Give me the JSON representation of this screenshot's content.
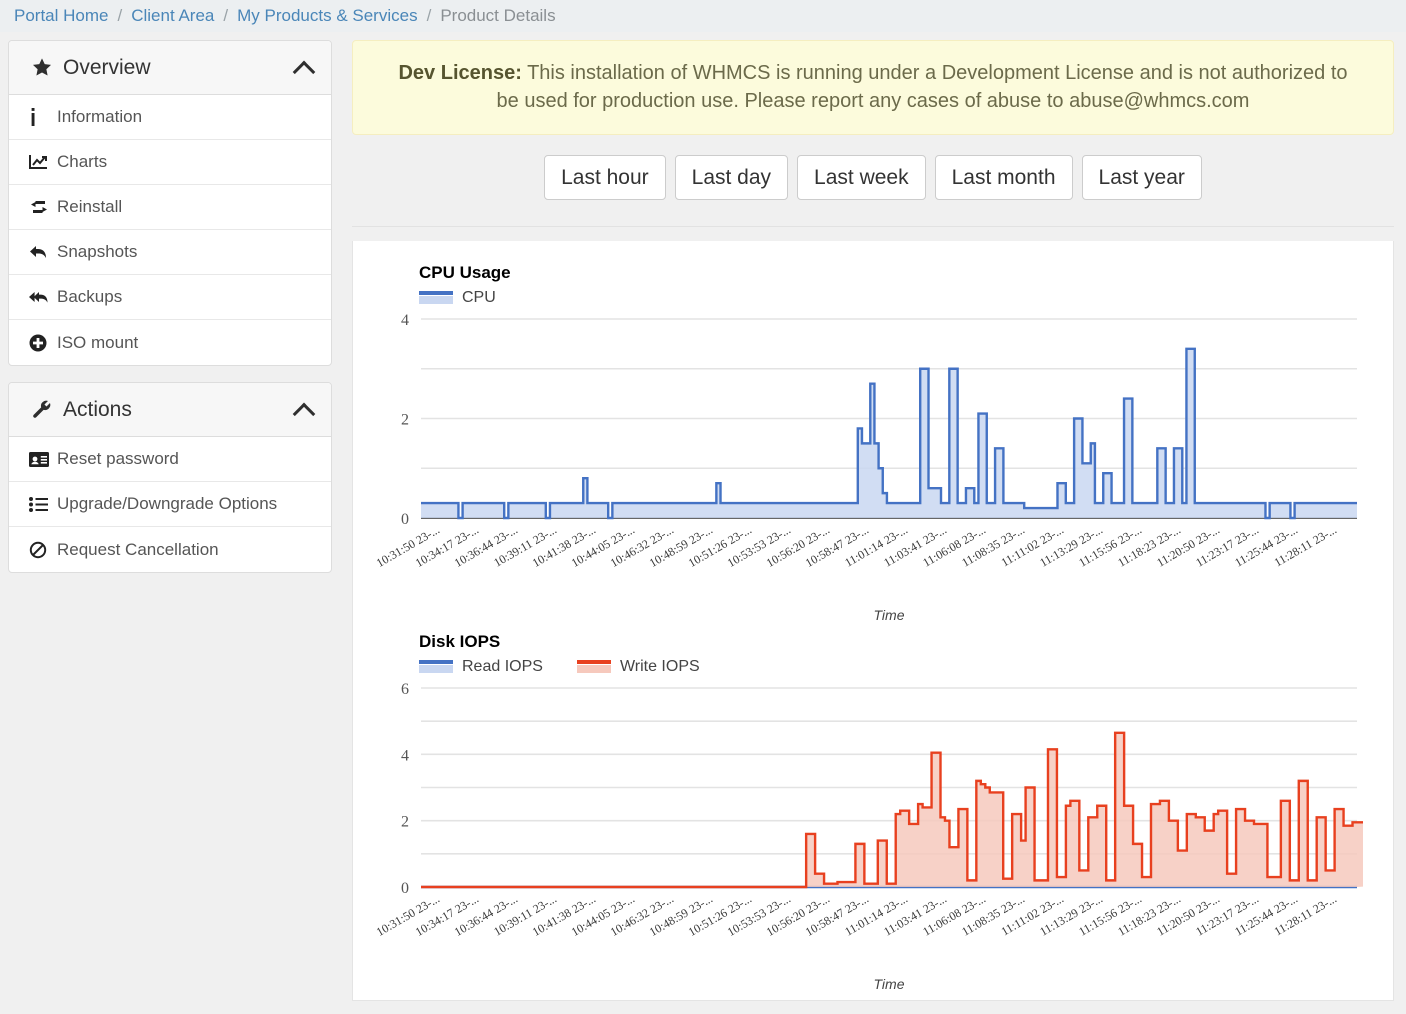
{
  "breadcrumb": {
    "items": [
      {
        "label": "Portal Home",
        "link": true
      },
      {
        "label": "Client Area",
        "link": true
      },
      {
        "label": "My Products & Services",
        "link": true
      },
      {
        "label": "Product Details",
        "link": false
      }
    ],
    "separator": "/"
  },
  "sidebar": {
    "panels": [
      {
        "title": "Overview",
        "header_icon": "star-icon",
        "collapse_icon": "chevron-up-icon",
        "items": [
          {
            "label": "Information",
            "icon": "info-icon"
          },
          {
            "label": "Charts",
            "icon": "chart-line-icon"
          },
          {
            "label": "Reinstall",
            "icon": "retweet-icon"
          },
          {
            "label": "Snapshots",
            "icon": "reply-icon"
          },
          {
            "label": "Backups",
            "icon": "reply-all-icon"
          },
          {
            "label": "ISO mount",
            "icon": "plus-circle-icon"
          }
        ]
      },
      {
        "title": "Actions",
        "header_icon": "wrench-icon",
        "collapse_icon": "chevron-up-icon",
        "items": [
          {
            "label": "Reset password",
            "icon": "id-card-icon"
          },
          {
            "label": "Upgrade/Downgrade Options",
            "icon": "list-ul-icon"
          },
          {
            "label": "Request Cancellation",
            "icon": "ban-icon"
          }
        ]
      }
    ]
  },
  "alert": {
    "strong": "Dev License:",
    "text": " This installation of WHMCS is running under a Development License and is not authorized to be used for production use. Please report any cases of abuse to abuse@whmcs.com"
  },
  "range_buttons": [
    {
      "label": "Last hour"
    },
    {
      "label": "Last day"
    },
    {
      "label": "Last week"
    },
    {
      "label": "Last month"
    },
    {
      "label": "Last year"
    }
  ],
  "colors": {
    "blue_stroke": "#4472c4",
    "blue_fill": "#c9d7f1",
    "red_stroke": "#e8401f",
    "red_fill": "#f6c9bd",
    "grid": "#e3e3e3",
    "axis": "#333333",
    "breadcrumb_link": "#4a86b8",
    "alert_bg": "#fcfbdc"
  },
  "chart_data": [
    {
      "type": "area",
      "title": "CPU Usage",
      "xlabel": "Time",
      "ylabel": "",
      "ylim": [
        0,
        4
      ],
      "yticks": [
        0,
        2,
        4
      ],
      "gridstep": 1,
      "grid": true,
      "legend": [
        {
          "name": "CPU",
          "color": "#4472c4"
        }
      ],
      "legend_position": "top-left",
      "xticks": [
        "10:31:50 23-...",
        "10:34:17 23-...",
        "10:36:44 23-...",
        "10:39:11 23-...",
        "10:41:38 23-...",
        "10:44:05 23-...",
        "10:46:32 23-...",
        "10:48:59 23-...",
        "10:51:26 23-...",
        "10:53:53 23-...",
        "10:56:20 23-...",
        "10:58:47 23-...",
        "11:01:14 23-...",
        "11:03:41 23-...",
        "11:06:08 23-...",
        "11:08:35 23-...",
        "11:11:02 23-...",
        "11:13:29 23-...",
        "11:15:56 23-...",
        "11:18:23 23-...",
        "11:20:50 23-...",
        "11:23:17 23-...",
        "11:25:44 23-...",
        "11:28:11 23-..."
      ],
      "series": [
        {
          "name": "CPU",
          "values": [
            0.3,
            0.3,
            0.3,
            0.3,
            0.3,
            0.3,
            0.3,
            0.3,
            0.3,
            0.0,
            0.3,
            0.3,
            0.3,
            0.3,
            0.3,
            0.3,
            0.3,
            0.3,
            0.3,
            0.3,
            0.0,
            0.3,
            0.3,
            0.3,
            0.3,
            0.3,
            0.3,
            0.3,
            0.3,
            0.3,
            0.0,
            0.3,
            0.3,
            0.3,
            0.3,
            0.3,
            0.3,
            0.3,
            0.3,
            0.8,
            0.3,
            0.3,
            0.3,
            0.3,
            0.3,
            0.0,
            0.3,
            0.3,
            0.3,
            0.3,
            0.3,
            0.3,
            0.3,
            0.3,
            0.3,
            0.3,
            0.3,
            0.3,
            0.3,
            0.3,
            0.3,
            0.3,
            0.3,
            0.3,
            0.3,
            0.3,
            0.3,
            0.3,
            0.3,
            0.3,
            0.3,
            0.7,
            0.3,
            0.3,
            0.3,
            0.3,
            0.3,
            0.3,
            0.3,
            0.3,
            0.3,
            0.3,
            0.3,
            0.3,
            0.3,
            0.3,
            0.3,
            0.3,
            0.3,
            0.3,
            0.3,
            0.3,
            0.3,
            0.3,
            0.3,
            0.3,
            0.3,
            0.3,
            0.3,
            0.3,
            0.3,
            0.3,
            0.3,
            0.3,
            0.3,
            1.8,
            1.5,
            1.5,
            2.7,
            1.5,
            1.0,
            0.5,
            0.3,
            0.3,
            0.3,
            0.3,
            0.3,
            0.3,
            0.3,
            0.3,
            3.0,
            3.0,
            0.6,
            0.6,
            0.6,
            0.3,
            0.3,
            3.0,
            3.0,
            0.3,
            0.3,
            0.6,
            0.6,
            0.3,
            2.1,
            2.1,
            0.3,
            0.3,
            1.4,
            1.4,
            0.3,
            0.3,
            0.3,
            0.3,
            0.3,
            0.2,
            0.2,
            0.2,
            0.2,
            0.2,
            0.2,
            0.2,
            0.2,
            0.7,
            0.7,
            0.3,
            0.3,
            2.0,
            2.0,
            1.1,
            1.1,
            1.5,
            0.3,
            0.3,
            0.9,
            0.9,
            0.3,
            0.3,
            0.3,
            2.4,
            2.4,
            0.3,
            0.3,
            0.3,
            0.3,
            0.3,
            0.3,
            1.4,
            1.4,
            0.3,
            0.3,
            1.4,
            1.4,
            0.3,
            3.4,
            3.4,
            0.3,
            0.3,
            0.3,
            0.3,
            0.3,
            0.3,
            0.3,
            0.3,
            0.3,
            0.3,
            0.3,
            0.3,
            0.3,
            0.3,
            0.3,
            0.3,
            0.3,
            0.0,
            0.3,
            0.3,
            0.3,
            0.3,
            0.3,
            0.0,
            0.3,
            0.3,
            0.3,
            0.3,
            0.3,
            0.3,
            0.3,
            0.3,
            0.3,
            0.3,
            0.3,
            0.3,
            0.3,
            0.3,
            0.3,
            0.3
          ]
        }
      ]
    },
    {
      "type": "area",
      "title": "Disk IOPS",
      "xlabel": "Time",
      "ylabel": "",
      "ylim": [
        0,
        6
      ],
      "yticks": [
        0,
        2,
        4,
        6
      ],
      "gridstep": 1,
      "grid": true,
      "legend": [
        {
          "name": "Read IOPS",
          "color": "#4472c4"
        },
        {
          "name": "Write IOPS",
          "color": "#e8401f"
        }
      ],
      "legend_position": "top-left",
      "xticks": [
        "10:31:50 23-...",
        "10:34:17 23-...",
        "10:36:44 23-...",
        "10:39:11 23-...",
        "10:41:38 23-...",
        "10:44:05 23-...",
        "10:46:32 23-...",
        "10:48:59 23-...",
        "10:51:26 23-...",
        "10:53:53 23-...",
        "10:56:20 23-...",
        "10:58:47 23-...",
        "11:01:14 23-...",
        "11:03:41 23-...",
        "11:06:08 23-...",
        "11:08:35 23-...",
        "11:11:02 23-...",
        "11:13:29 23-...",
        "11:15:56 23-...",
        "11:18:23 23-...",
        "11:20:50 23-...",
        "11:23:17 23-...",
        "11:25:44 23-...",
        "11:28:11 23-..."
      ],
      "series": [
        {
          "name": "Read IOPS",
          "values": [
            0,
            0,
            0,
            0,
            0,
            0,
            0,
            0,
            0,
            0,
            0,
            0,
            0,
            0,
            0,
            0,
            0,
            0,
            0,
            0,
            0,
            0,
            0,
            0,
            0,
            0,
            0,
            0,
            0,
            0,
            0,
            0,
            0,
            0,
            0,
            0,
            0,
            0,
            0,
            0,
            0,
            0,
            0,
            0,
            0,
            0,
            0,
            0,
            0,
            0,
            0,
            0,
            0,
            0,
            0,
            0,
            0,
            0,
            0,
            0,
            0,
            0,
            0,
            0,
            0,
            0,
            0,
            0,
            0,
            0,
            0,
            0,
            0,
            0,
            0,
            0,
            0,
            0,
            0,
            0,
            0,
            0,
            0,
            0,
            0,
            0,
            0,
            0,
            0,
            0,
            0,
            0,
            0,
            0,
            0,
            0,
            0,
            0,
            0,
            0,
            0,
            0,
            0,
            0,
            0,
            0,
            0,
            0,
            0,
            0,
            0,
            0,
            0,
            0,
            0,
            0,
            0,
            0,
            0,
            0,
            0,
            0,
            0,
            0,
            0,
            0,
            0,
            0,
            0,
            0,
            0,
            0,
            0,
            0,
            0,
            0,
            0,
            0,
            0,
            0,
            0,
            0,
            0,
            0,
            0,
            0,
            0,
            0,
            0,
            0,
            0,
            0,
            0,
            0,
            0,
            0,
            0,
            0,
            0,
            0,
            0,
            0,
            0,
            0,
            0,
            0,
            0,
            0,
            0,
            0,
            0,
            0,
            0,
            0,
            0,
            0,
            0,
            0,
            0,
            0,
            0,
            0,
            0,
            0,
            0,
            0,
            0,
            0,
            0,
            0,
            0,
            0,
            0,
            0,
            0,
            0,
            0,
            0,
            0,
            0,
            0,
            0,
            0,
            0,
            0,
            0,
            0,
            0,
            0,
            0
          ]
        },
        {
          "name": "Write IOPS",
          "values": [
            0,
            0,
            0,
            0,
            0,
            0,
            0,
            0,
            0,
            0,
            0,
            0,
            0,
            0,
            0,
            0,
            0,
            0,
            0,
            0,
            0,
            0,
            0,
            0,
            0,
            0,
            0,
            0,
            0,
            0,
            0,
            0,
            0,
            0,
            0,
            0,
            0,
            0,
            0,
            0,
            0,
            0,
            0,
            0,
            0,
            0,
            0,
            0,
            0,
            0,
            0,
            0,
            0,
            0,
            0,
            0,
            0,
            0,
            0,
            0,
            0,
            0,
            0,
            0,
            0,
            0,
            0,
            0,
            0,
            0,
            0,
            0,
            0,
            0,
            0,
            0,
            0,
            0,
            0,
            0,
            0,
            0,
            0,
            0,
            0,
            0,
            1.6,
            1.6,
            0.4,
            0.4,
            0.1,
            0.1,
            0.1,
            0.15,
            0.15,
            0.15,
            0.15,
            1.3,
            1.3,
            0.1,
            0.1,
            0.1,
            1.4,
            1.4,
            0.1,
            0.1,
            2.2,
            2.3,
            2.3,
            1.9,
            1.9,
            2.5,
            2.4,
            2.4,
            4.05,
            4.05,
            2.1,
            2.0,
            1.2,
            1.2,
            2.35,
            2.35,
            0.2,
            0.2,
            3.2,
            3.1,
            3.0,
            2.85,
            2.85,
            2.85,
            0.25,
            0.25,
            2.2,
            2.2,
            1.4,
            3.0,
            3.0,
            0.2,
            0.2,
            0.2,
            4.15,
            4.15,
            0.3,
            0.3,
            2.45,
            2.6,
            2.6,
            0.5,
            0.5,
            2.1,
            2.1,
            2.45,
            2.45,
            0.2,
            0.2,
            4.65,
            4.65,
            2.45,
            2.45,
            1.3,
            1.3,
            0.3,
            0.3,
            2.5,
            2.5,
            2.6,
            2.6,
            2.0,
            2.0,
            1.1,
            1.1,
            2.2,
            2.2,
            2.1,
            2.1,
            1.7,
            1.7,
            2.2,
            2.3,
            2.3,
            0.4,
            0.4,
            2.35,
            2.35,
            2.0,
            2.0,
            1.9,
            1.9,
            1.9,
            0.3,
            0.3,
            0.3,
            2.6,
            2.6,
            0.2,
            0.2,
            3.2,
            3.2,
            0.2,
            0.2,
            2.1,
            2.1,
            0.5,
            0.5,
            2.35,
            2.35,
            1.85,
            1.85,
            1.95,
            1.95,
            1.95,
            0.1,
            0.05,
            0.05,
            0.05,
            0.05,
            0.05,
            0.05,
            0.05,
            0.05,
            0.05,
            0.05,
            0.05,
            0.05,
            0.05,
            0.05,
            0.05,
            0.05,
            0.05,
            0.05,
            0.2
          ]
        }
      ]
    }
  ]
}
